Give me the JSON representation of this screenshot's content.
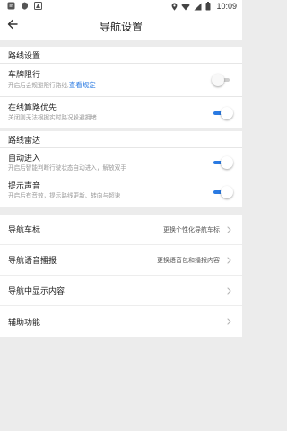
{
  "status_bar": {
    "time": "10:09"
  },
  "header": {
    "title": "导航设置"
  },
  "route_settings": {
    "section_title": "路线设置",
    "plate_limit": {
      "title": "车牌限行",
      "desc": "开启后会规避限行路线,",
      "link": "查看规定",
      "enabled": false
    },
    "realtime_priority": {
      "title": "在线算路优先",
      "desc": "关闭则无法根据实时路况躲避拥堵",
      "enabled": true
    }
  },
  "route_radar": {
    "section_title": "路线雷达",
    "auto_enter": {
      "title": "自动进入",
      "desc": "开启后智能判断行驶状态自动进入，解放双手",
      "enabled": true
    },
    "sound": {
      "title": "提示声音",
      "desc": "开启后有音效，提示路线更新、转向与超速",
      "enabled": true
    }
  },
  "nav_items": [
    {
      "label": "导航车标",
      "value": "更换个性化导航车标"
    },
    {
      "label": "导航语音播报",
      "value": "更换语音包和播报内容"
    },
    {
      "label": "导航中显示内容",
      "value": ""
    },
    {
      "label": "辅助功能",
      "value": ""
    }
  ],
  "colors": {
    "accent": "#2a7ae2",
    "background": "#ececec"
  }
}
